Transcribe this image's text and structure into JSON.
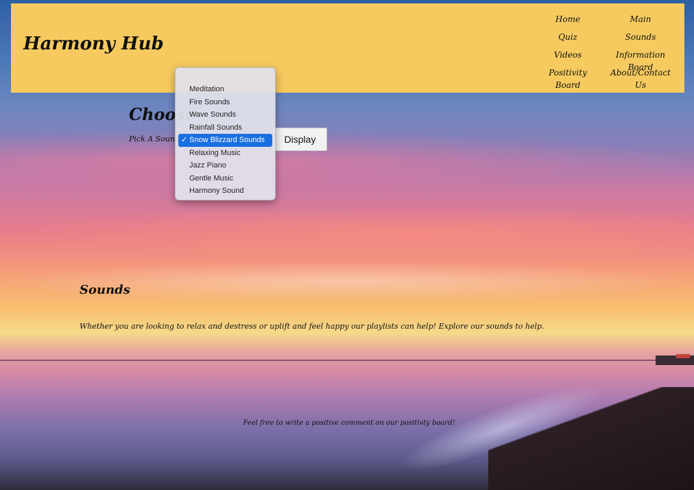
{
  "site": {
    "brand": "Harmony Hub"
  },
  "nav": {
    "items": [
      {
        "label": "Home"
      },
      {
        "label": "Main"
      },
      {
        "label": "Quiz"
      },
      {
        "label": "Sounds"
      },
      {
        "label": "Videos"
      },
      {
        "label": "Information Board"
      },
      {
        "label": "Positivity Board"
      },
      {
        "label": "About/Contact Us"
      }
    ]
  },
  "chooser": {
    "title": "Choose",
    "pick_label": "Pick A Sound:",
    "button_label": "Display",
    "selected": "Snow Blizzard Sounds",
    "options": [
      {
        "label": "Meditation"
      },
      {
        "label": "Fire Sounds"
      },
      {
        "label": "Wave Sounds"
      },
      {
        "label": "Rainfall Sounds"
      },
      {
        "label": "Snow Blizzard Sounds"
      },
      {
        "label": "Relaxing Music"
      },
      {
        "label": "Jazz Piano"
      },
      {
        "label": "Gentle Music"
      },
      {
        "label": "Harmony Sound"
      }
    ],
    "check_glyph": "✓"
  },
  "content": {
    "heading": "Sounds",
    "intro": "Whether you are looking to relax and destress or uplift and feel happy our playlists can help! Explore our sounds to help.",
    "footer_note": "Feel free to write a positive comment on our positivty board!"
  },
  "colors": {
    "header_bg": "#f6ca5f",
    "selected_option_bg": "#1a6fe0"
  }
}
